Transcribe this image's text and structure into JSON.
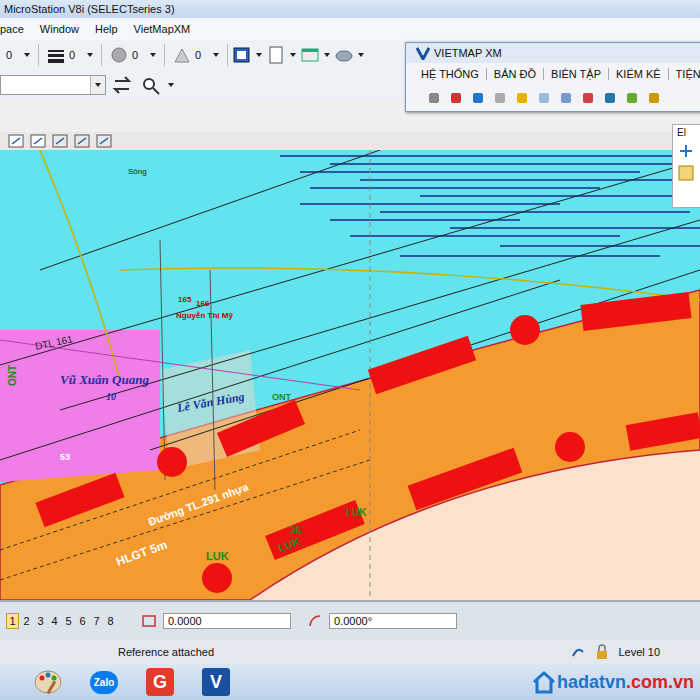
{
  "window": {
    "title": "MicroStation V8i (SELECTseries 3)"
  },
  "menu": [
    "pace",
    "Window",
    "Help",
    "VietMapXM"
  ],
  "toolbar": {
    "values": [
      "0",
      "0",
      "0",
      "0"
    ]
  },
  "vietmap_window": {
    "title": "VIETMAP XM",
    "menu": [
      "HỆ THỐNG",
      "BẢN ĐỒ",
      "BIÊN TẬP",
      "KIỂM KÊ",
      "TIỆN"
    ]
  },
  "side_panel": {
    "title": "El"
  },
  "map": {
    "labels": [
      "Sông",
      "165",
      "166",
      "Nguyễn Thị Mỹ",
      "DTL 161",
      "Vũ Xuân Quang",
      "10",
      "Lê Văn Hùng",
      "ONT",
      "ONT",
      "53",
      "Đường TL.291 nhựa",
      "HLGT 5m",
      "LUK",
      "LUK",
      "36",
      "LUK"
    ]
  },
  "view_tabs": [
    {
      "label": "1",
      "selected": true
    },
    {
      "label": "2",
      "selected": false
    },
    {
      "label": "3",
      "selected": false
    },
    {
      "label": "4",
      "selected": false
    },
    {
      "label": "5",
      "selected": false
    },
    {
      "label": "6",
      "selected": false
    },
    {
      "label": "7",
      "selected": false
    },
    {
      "label": "8",
      "selected": false
    }
  ],
  "fields": {
    "distance": "0.0000",
    "angle": "0.0000°"
  },
  "status_bar": {
    "message": "Reference attached",
    "level": "Level 10"
  },
  "taskbar": [
    {
      "label": "Zalo"
    },
    {
      "label": "G"
    },
    {
      "label": "V"
    }
  ],
  "watermark": {
    "name": "hadatvn",
    "domain": ".com.vn"
  }
}
